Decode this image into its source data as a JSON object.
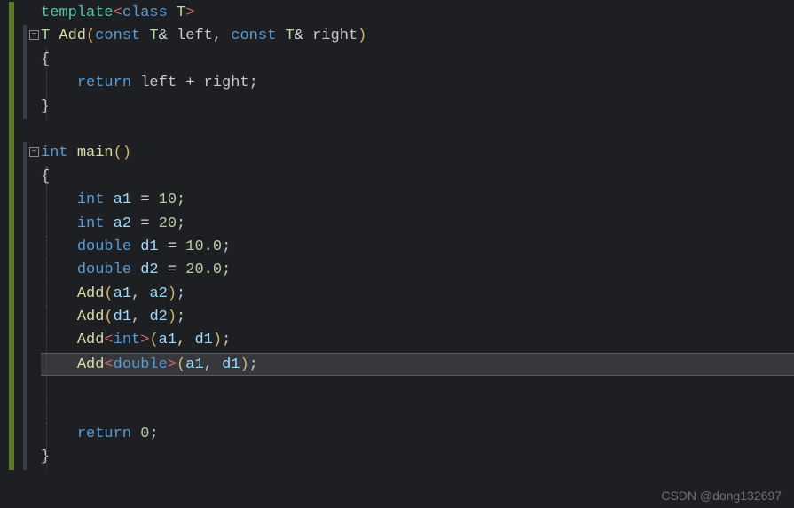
{
  "lines": [
    {
      "guides": [],
      "html": "<span class='kw'>template</span><span class='angle'>&lt;</span><span class='kw2'>class</span><span class='txt'> </span><span class='tmpl'>T</span><span class='angle'>&gt;</span>",
      "fold": false
    },
    {
      "guides": [],
      "html": "<span class='tmpl'>T</span><span class='txt'> </span><span class='fn'>Add</span><span class='paren'>(</span><span class='kw2'>const</span><span class='txt'> </span><span class='tmpl'>T</span><span class='op'>&amp; </span><span class='txt'>left</span><span class='punc'>, </span><span class='kw2'>const</span><span class='txt'> </span><span class='tmpl'>T</span><span class='op'>&amp; </span><span class='txt'>right</span><span class='paren'>)</span>",
      "fold": true
    },
    {
      "guides": [
        0
      ],
      "html": "<span class='punc'>{</span>",
      "fold": false
    },
    {
      "guides": [
        0
      ],
      "html": "    <span class='kw2'>return</span><span class='txt'> left </span><span class='op'>+</span><span class='txt'> right</span><span class='punc'>;</span>",
      "fold": false
    },
    {
      "guides": [
        0
      ],
      "html": "<span class='punc'>}</span>",
      "fold": false
    },
    {
      "guides": [],
      "html": "",
      "fold": false
    },
    {
      "guides": [],
      "html": "<span class='kw2'>int</span><span class='txt'> </span><span class='fn'>main</span><span class='paren'>()</span>",
      "fold": true
    },
    {
      "guides": [
        0
      ],
      "html": "<span class='punc'>{</span>",
      "fold": false
    },
    {
      "guides": [
        0
      ],
      "html": "    <span class='kw2'>int</span><span class='txt'> </span><span class='var'>a1</span><span class='txt'> </span><span class='op'>=</span><span class='txt'> </span><span class='num'>10</span><span class='punc'>;</span>",
      "fold": false
    },
    {
      "guides": [
        0
      ],
      "html": "    <span class='kw2'>int</span><span class='txt'> </span><span class='var'>a2</span><span class='txt'> </span><span class='op'>=</span><span class='txt'> </span><span class='num'>20</span><span class='punc'>;</span>",
      "fold": false
    },
    {
      "guides": [
        0
      ],
      "html": "    <span class='kw2'>double</span><span class='txt'> </span><span class='var'>d1</span><span class='txt'> </span><span class='op'>=</span><span class='txt'> </span><span class='num'>10.0</span><span class='punc'>;</span>",
      "fold": false
    },
    {
      "guides": [
        0
      ],
      "html": "    <span class='kw2'>double</span><span class='txt'> </span><span class='var'>d2</span><span class='txt'> </span><span class='op'>=</span><span class='txt'> </span><span class='num'>20.0</span><span class='punc'>;</span>",
      "fold": false
    },
    {
      "guides": [
        0
      ],
      "html": "    <span class='fn'>Add</span><span class='paren'>(</span><span class='var'>a1</span><span class='punc'>, </span><span class='var'>a2</span><span class='paren'>)</span><span class='punc'>;</span>",
      "fold": false
    },
    {
      "guides": [
        0
      ],
      "html": "    <span class='fn'>Add</span><span class='paren'>(</span><span class='var'>d1</span><span class='punc'>, </span><span class='var'>d2</span><span class='paren'>)</span><span class='punc'>;</span>",
      "fold": false
    },
    {
      "guides": [
        0
      ],
      "html": "    <span class='fn'>Add</span><span class='angle'>&lt;</span><span class='kw2'>int</span><span class='angle'>&gt;</span><span class='paren'>(</span><span class='var'>a1</span><span class='punc'>, </span><span class='var'>d1</span><span class='paren'>)</span><span class='punc'>;</span>",
      "fold": false
    },
    {
      "guides": [
        0
      ],
      "html": "    <span class='fn'>Add</span><span class='angle'>&lt;</span><span class='kw2'>double</span><span class='angle'>&gt;</span><span class='paren'>(</span><span class='var'>a1</span><span class='punc'>, </span><span class='var'>d1</span><span class='paren'>)</span><span class='punc'>;</span>",
      "fold": false,
      "highlight": true
    },
    {
      "guides": [
        0
      ],
      "html": "",
      "fold": false
    },
    {
      "guides": [
        0
      ],
      "html": "",
      "fold": false
    },
    {
      "guides": [
        0
      ],
      "html": "    <span class='kw2'>return</span><span class='txt'> </span><span class='num'>0</span><span class='punc'>;</span>",
      "fold": false
    },
    {
      "guides": [
        0
      ],
      "html": "<span class='punc'>}</span>",
      "fold": false
    }
  ],
  "fold_glyph": "−",
  "watermark": "CSDN @dong132697"
}
